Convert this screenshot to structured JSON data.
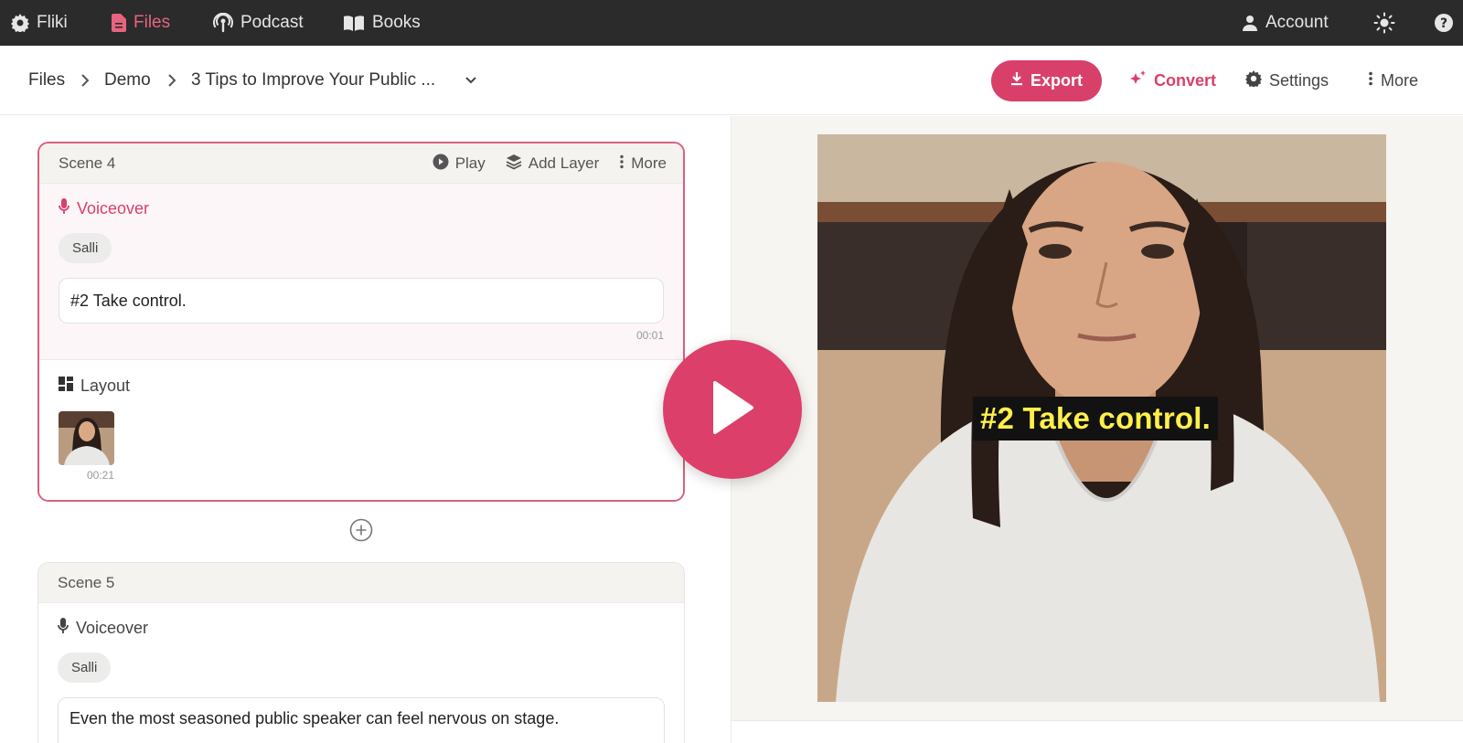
{
  "topnav": {
    "items": [
      {
        "label": "Fliki",
        "icon": "gear-logo-icon"
      },
      {
        "label": "Files",
        "icon": "file-icon",
        "active": true
      },
      {
        "label": "Podcast",
        "icon": "podcast-icon"
      },
      {
        "label": "Books",
        "icon": "book-icon"
      }
    ],
    "account_label": "Account",
    "theme_icon": "sun-icon",
    "help_icon": "help-icon"
  },
  "toolbar": {
    "breadcrumb": [
      "Files",
      "Demo",
      "3 Tips to Improve Your Public ..."
    ],
    "export_label": "Export",
    "convert_label": "Convert",
    "settings_label": "Settings",
    "more_label": "More"
  },
  "scenes": [
    {
      "title": "Scene 4",
      "actions": {
        "play": "Play",
        "add_layer": "Add Layer",
        "more": "More"
      },
      "voiceover_label": "Voiceover",
      "voice": "Salli",
      "text": "#2 Take control.",
      "duration": "00:01",
      "layout_label": "Layout",
      "layout_duration": "00:21"
    },
    {
      "title": "Scene 5",
      "voiceover_label": "Voiceover",
      "voice": "Salli",
      "text": "Even the most seasoned public speaker can feel nervous on stage."
    }
  ],
  "preview": {
    "caption": "#2 Take control."
  },
  "colors": {
    "accent": "#d8406a",
    "nav_bg": "#2b2b2b",
    "caption_text": "#fff04a"
  }
}
